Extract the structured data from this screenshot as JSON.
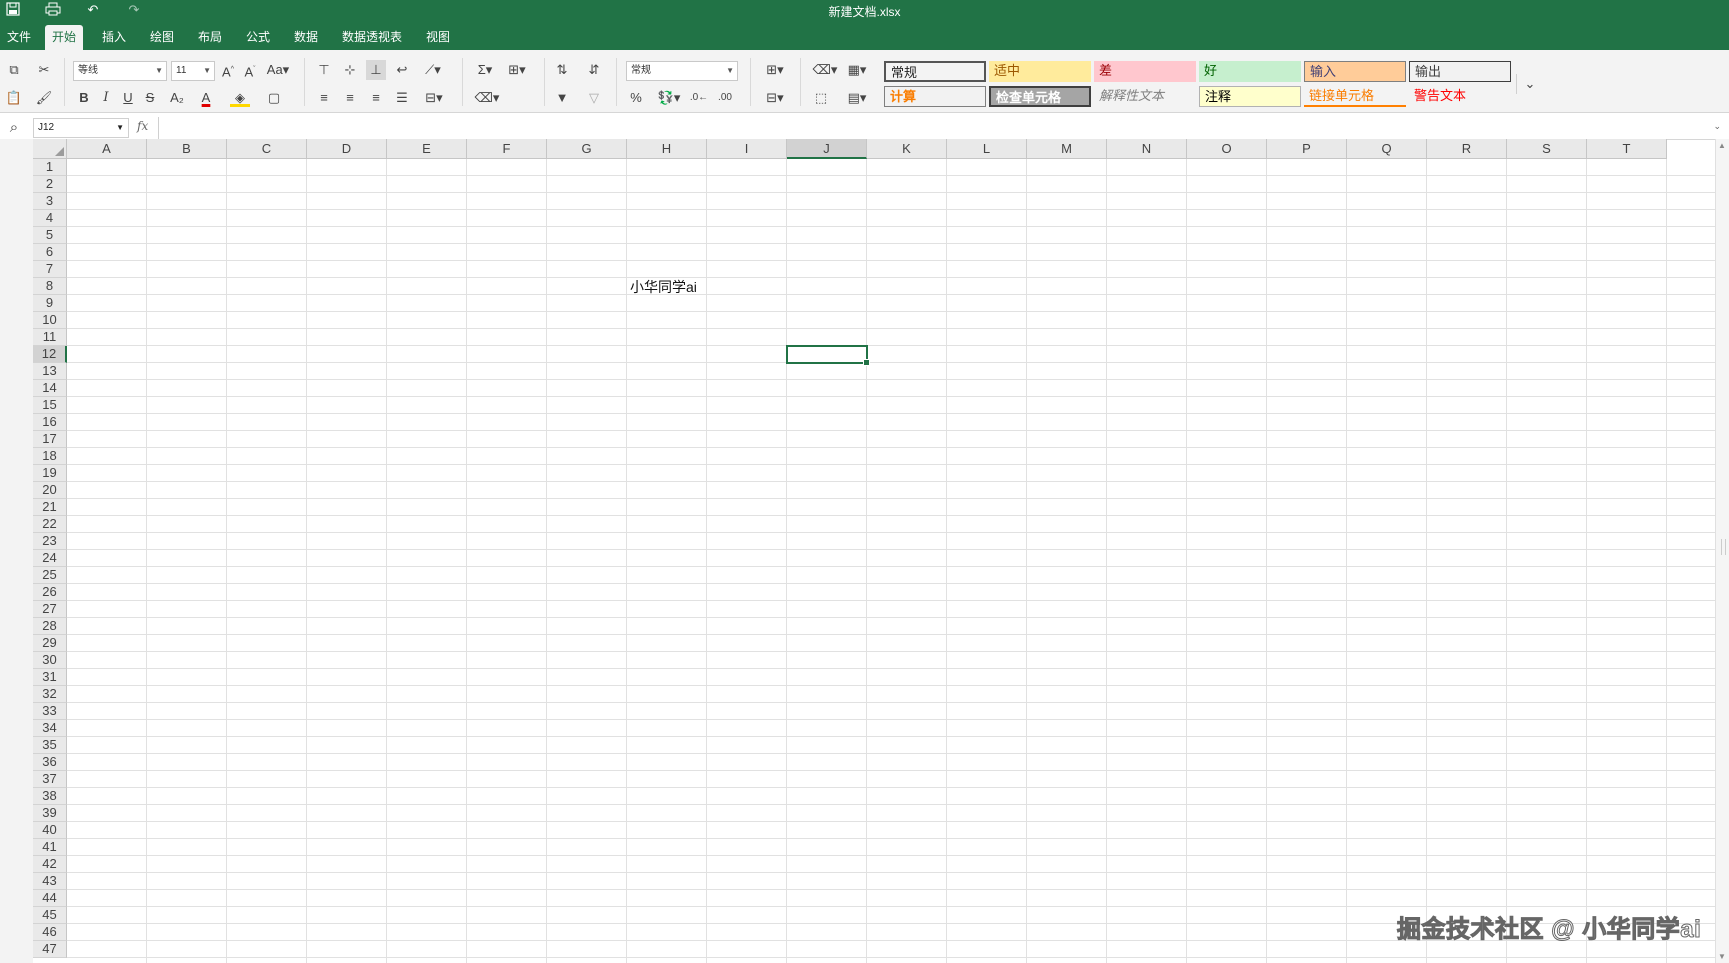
{
  "title": "新建文档.xlsx",
  "quick_access": {
    "save": "save-icon",
    "print": "print-icon",
    "undo": "undo-icon",
    "redo": "redo-icon"
  },
  "tabs": [
    "文件",
    "开始",
    "插入",
    "绘图",
    "布局",
    "公式",
    "数据",
    "数据透视表",
    "视图"
  ],
  "active_tab": "开始",
  "ribbon": {
    "font_name": "等线",
    "font_size": "11",
    "number_format": "常规",
    "buttons": {
      "bold": "B",
      "italic": "I",
      "underline": "U",
      "strike": "S",
      "subscript": "A₂",
      "font_color": "A",
      "percent": "%"
    }
  },
  "cell_styles": [
    {
      "label": "常规",
      "bg": "#ffffff",
      "color": "#000000",
      "border": "#555555"
    },
    {
      "label": "适中",
      "bg": "#ffeb9c",
      "color": "#9c5700",
      "border": "#ffeb9c"
    },
    {
      "label": "差",
      "bg": "#ffc7ce",
      "color": "#9c0006",
      "border": "#ffc7ce"
    },
    {
      "label": "好",
      "bg": "#c6efce",
      "color": "#006100",
      "border": "#c6efce"
    },
    {
      "label": "输入",
      "bg": "#ffcc99",
      "color": "#3f3f76",
      "border": "#7f7f7f"
    },
    {
      "label": "输出",
      "bg": "#f2f2f2",
      "color": "#3f3f3f",
      "border": "#3f3f3f"
    },
    {
      "label": "计算",
      "bg": "#f2f2f2",
      "color": "#fa7d00",
      "border": "#7f7f7f"
    },
    {
      "label": "检查单元格",
      "bg": "#a5a5a5",
      "color": "#ffffff",
      "border": "#3f3f3f"
    },
    {
      "label": "解释性文本",
      "bg": "#f3f3f3",
      "color": "#7f7f7f",
      "border": "#f3f3f3"
    },
    {
      "label": "注释",
      "bg": "#ffffcc",
      "color": "#000000",
      "border": "#b2b2b2"
    },
    {
      "label": "链接单元格",
      "bg": "#f3f3f3",
      "color": "#fa7d00",
      "border": "#f3f3f3"
    },
    {
      "label": "警告文本",
      "bg": "#f3f3f3",
      "color": "#ff0000",
      "border": "#f3f3f3"
    }
  ],
  "formula_bar": {
    "name_box": "J12",
    "fx": "fx",
    "value": ""
  },
  "columns": [
    "A",
    "B",
    "C",
    "D",
    "E",
    "F",
    "G",
    "H",
    "I",
    "J",
    "K",
    "L",
    "M",
    "N",
    "O",
    "P",
    "Q",
    "R",
    "S",
    "T"
  ],
  "selected_column": "J",
  "row_count": 47,
  "selected_row": 12,
  "cells": [
    {
      "ref": "H8",
      "value": "小华同学ai"
    }
  ],
  "active_cell": "J12",
  "watermark": "掘金技术社区 @ 小华同学ai",
  "colors": {
    "brand": "#217346"
  }
}
